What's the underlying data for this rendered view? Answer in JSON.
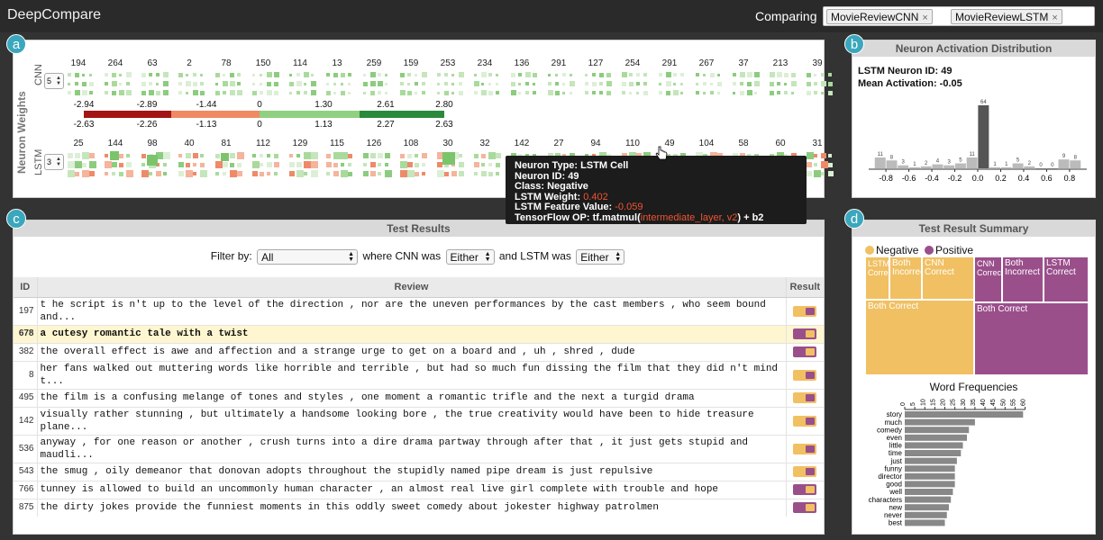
{
  "app": {
    "title": "DeepCompare",
    "comparing_label": "Comparing",
    "models": [
      {
        "label": "MovieReviewCNN",
        "remove": "×"
      },
      {
        "label": "MovieReviewLSTM",
        "remove": "×"
      }
    ]
  },
  "colors": {
    "positive": "#9a4f8b",
    "negative": "#f0c063",
    "badge": "#3aa7bd"
  },
  "panel_a": {
    "badge": "a",
    "axis_label": "Neuron Weights",
    "cnn": {
      "label": "CNN",
      "stepper": "5",
      "neuron_ids": [
        "194",
        "264",
        "63",
        "2",
        "78",
        "150",
        "114",
        "13",
        "259",
        "159",
        "253",
        "234",
        "136",
        "291",
        "127",
        "254",
        "291",
        "267",
        "37",
        "213",
        "39"
      ]
    },
    "lstm": {
      "label": "LSTM",
      "stepper": "3",
      "neuron_ids": [
        "25",
        "144",
        "98",
        "40",
        "81",
        "112",
        "129",
        "115",
        "126",
        "108",
        "30",
        "32",
        "142",
        "27",
        "94",
        "110",
        "49",
        "104",
        "58",
        "60",
        "31"
      ]
    },
    "legend": {
      "top": [
        "-2.94",
        "-2.89",
        "-1.44",
        "0",
        "1.30",
        "2.61",
        "2.80"
      ],
      "bottom": [
        "-2.63",
        "-2.26",
        "-1.13",
        "0",
        "1.13",
        "2.27",
        "2.63"
      ]
    }
  },
  "tooltip": {
    "neuron_type": "Neuron Type: LSTM Cell",
    "neuron_id": "Neuron ID: 49",
    "class": "Class: Negative",
    "weight_label": "LSTM Weight:",
    "weight": "0.402",
    "feature_label": "LSTM Feature Value:",
    "feature": "-0.059",
    "tf_label": "TensorFlow OP: tf.matmul(",
    "tf_arg": "intermediate_layer, v2",
    "tf_end": ") + b2"
  },
  "panel_b": {
    "badge": "b",
    "title": "Neuron Activation Distribution",
    "neuron_id": "LSTM Neuron ID: 49",
    "mean": "Mean Activation: -0.05",
    "chart_data": {
      "type": "bar",
      "bins": [
        -0.85,
        -0.75,
        -0.65,
        -0.55,
        -0.45,
        -0.35,
        -0.25,
        -0.15,
        -0.05,
        0.05,
        0.15,
        0.25,
        0.35,
        0.45,
        0.55,
        0.65,
        0.75,
        0.85
      ],
      "values": [
        11,
        8,
        3,
        1,
        2,
        4,
        3,
        5,
        11,
        64,
        1,
        1,
        5,
        2,
        0,
        0,
        9,
        8
      ],
      "x_ticks": [
        "-0.8",
        "-0.6",
        "-0.4",
        "-0.2",
        "0.0",
        "0.2",
        "0.4",
        "0.6",
        "0.8"
      ]
    }
  },
  "panel_c": {
    "badge": "c",
    "title": "Test Results",
    "filter_label": "Filter by:",
    "filter_value": "All",
    "where_cnn": "where CNN was",
    "cnn_value": "Either",
    "and_lstm": "and LSTM was",
    "lstm_value": "Either",
    "col_id": "ID",
    "col_review": "Review",
    "col_result": "Result",
    "rows": [
      {
        "id": "197",
        "text": "t he script is n't up to the level of the direction , nor are the uneven performances by the cast members , who seem bound and...",
        "cls": "neg",
        "hl": false
      },
      {
        "id": "678",
        "text": "a cutesy romantic tale with a twist",
        "cls": "pos",
        "hl": true
      },
      {
        "id": "382",
        "text": "the overall effect is awe and affection and a strange urge to get on a board and , uh , shred , dude",
        "cls": "pos",
        "hl": false
      },
      {
        "id": "8",
        "text": "her fans walked out muttering words like horrible and terrible , but had so much fun dissing the film that they did n't mind t...",
        "cls": "neg",
        "hl": false
      },
      {
        "id": "495",
        "text": "the film is a confusing melange of tones and styles , one moment a romantic trifle and the next a turgid drama",
        "cls": "neg",
        "hl": false
      },
      {
        "id": "142",
        "text": "visually rather stunning , but ultimately a handsome looking bore , the true creativity would have been to hide treasure plane...",
        "cls": "neg",
        "hl": false
      },
      {
        "id": "536",
        "text": "anyway , for one reason or another , crush turns into a dire drama partway through after that , it just gets stupid and maudli...",
        "cls": "neg",
        "hl": false
      },
      {
        "id": "543",
        "text": "the smug , oily demeanor that donovan adopts throughout the stupidly named pipe dream is just repulsive",
        "cls": "neg",
        "hl": false
      },
      {
        "id": "766",
        "text": "tunney is allowed to build an uncommonly human character , an almost real live girl complete with trouble and hope",
        "cls": "pos",
        "hl": false
      },
      {
        "id": "875",
        "text": "the dirty jokes provide the funniest moments in this oddly sweet comedy about jokester highway patrolmen",
        "cls": "pos",
        "hl": false
      }
    ]
  },
  "panel_d": {
    "badge": "d",
    "title": "Test Result Summary",
    "legend_neg": "Negative",
    "legend_pos": "Positive",
    "treemap": {
      "lstm_correct_neg": "LSTM Correct",
      "both_incorrect_neg": "Both Incorrect",
      "cnn_correct_neg": "CNN Correct",
      "both_correct_neg": "Both Correct",
      "cnn_correct_pos": "CNN Correct",
      "both_incorrect_pos": "Both Incorrect",
      "lstm_correct_pos": "LSTM Correct",
      "both_correct_pos": "Both Correct"
    },
    "wf_title": "Word Frequencies",
    "chart_data": {
      "type": "bar",
      "orientation": "horizontal",
      "categories": [
        "story",
        "much",
        "comedy",
        "even",
        "little",
        "time",
        "just",
        "funny",
        "director",
        "good",
        "well",
        "characters",
        "new",
        "never",
        "best"
      ],
      "values": [
        59,
        35,
        32,
        31,
        29,
        28,
        26,
        25,
        25,
        25,
        24,
        23,
        22,
        21,
        20
      ],
      "x_ticks": [
        "0",
        "5",
        "10",
        "15",
        "20",
        "25",
        "30",
        "35",
        "40",
        "45",
        "50",
        "55",
        "60"
      ],
      "xlim": [
        0,
        62
      ]
    }
  }
}
